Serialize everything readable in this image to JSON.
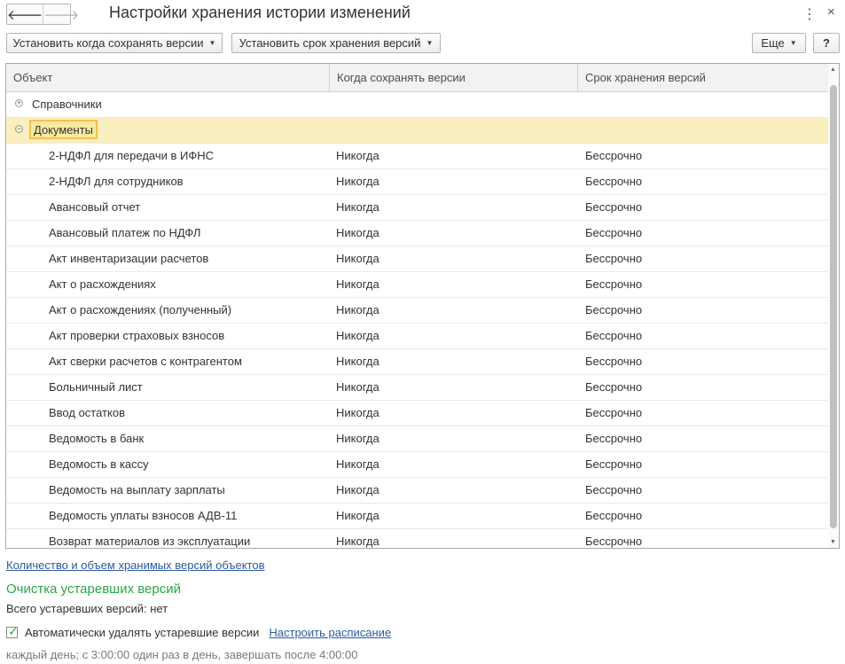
{
  "window": {
    "title": "Настройки хранения истории изменений",
    "back_glyph": "🡐",
    "fwd_glyph": "🡒",
    "more_glyph": "⋮",
    "close_glyph": "×"
  },
  "toolbar": {
    "when_save_label": "Установить когда сохранять версии",
    "retention_label": "Установить срок хранения версий",
    "more_label": "Еще",
    "help_label": "?",
    "caret": "▼"
  },
  "grid": {
    "columns": [
      "Объект",
      "Когда сохранять версии",
      "Срок хранения версий"
    ],
    "groups": [
      {
        "label": "Справочники",
        "toggle": "+",
        "expanded": false
      },
      {
        "label": "Документы",
        "toggle": "−",
        "expanded": true
      }
    ],
    "rows": [
      {
        "object": "2-НДФЛ для передачи в ИФНС",
        "when": "Никогда",
        "term": "Бессрочно"
      },
      {
        "object": "2-НДФЛ для сотрудников",
        "when": "Никогда",
        "term": "Бессрочно"
      },
      {
        "object": "Авансовый отчет",
        "when": "Никогда",
        "term": "Бессрочно"
      },
      {
        "object": "Авансовый платеж по НДФЛ",
        "when": "Никогда",
        "term": "Бессрочно"
      },
      {
        "object": "Акт инвентаризации расчетов",
        "when": "Никогда",
        "term": "Бессрочно"
      },
      {
        "object": "Акт о расхождениях",
        "when": "Никогда",
        "term": "Бессрочно"
      },
      {
        "object": "Акт о расхождениях (полученный)",
        "when": "Никогда",
        "term": "Бессрочно"
      },
      {
        "object": "Акт проверки страховых взносов",
        "when": "Никогда",
        "term": "Бессрочно"
      },
      {
        "object": "Акт сверки расчетов с контрагентом",
        "when": "Никогда",
        "term": "Бессрочно"
      },
      {
        "object": "Больничный лист",
        "when": "Никогда",
        "term": "Бессрочно"
      },
      {
        "object": "Ввод остатков",
        "when": "Никогда",
        "term": "Бессрочно"
      },
      {
        "object": "Ведомость в банк",
        "when": "Никогда",
        "term": "Бессрочно"
      },
      {
        "object": "Ведомость в кассу",
        "when": "Никогда",
        "term": "Бессрочно"
      },
      {
        "object": "Ведомость на выплату зарплаты",
        "when": "Никогда",
        "term": "Бессрочно"
      },
      {
        "object": "Ведомость уплаты взносов АДВ-11",
        "when": "Никогда",
        "term": "Бессрочно"
      },
      {
        "object": "Возврат материалов из эксплуатации",
        "when": "Никогда",
        "term": "Бессрочно"
      }
    ],
    "scroll_up": "▲",
    "scroll_down": "▼"
  },
  "footer": {
    "versions_link": "Количество и объем хранимых версий объектов",
    "cleanup_title": "Очистка устаревших версий",
    "total_outdated": "Всего устаревших версий: нет",
    "auto_delete_label": "Автоматически удалять устаревшие версии",
    "auto_delete_checked": true,
    "check_glyph": "✓",
    "schedule_link": "Настроить расписание",
    "schedule_text": "каждый день; с 3:00:00 один раз в день, завершать после 4:00:00"
  },
  "colors": {
    "accent_green": "#2aa548",
    "link_blue": "#2c5aa0",
    "selected_row": "#fbefbf",
    "focus_border": "#f2c14e"
  }
}
